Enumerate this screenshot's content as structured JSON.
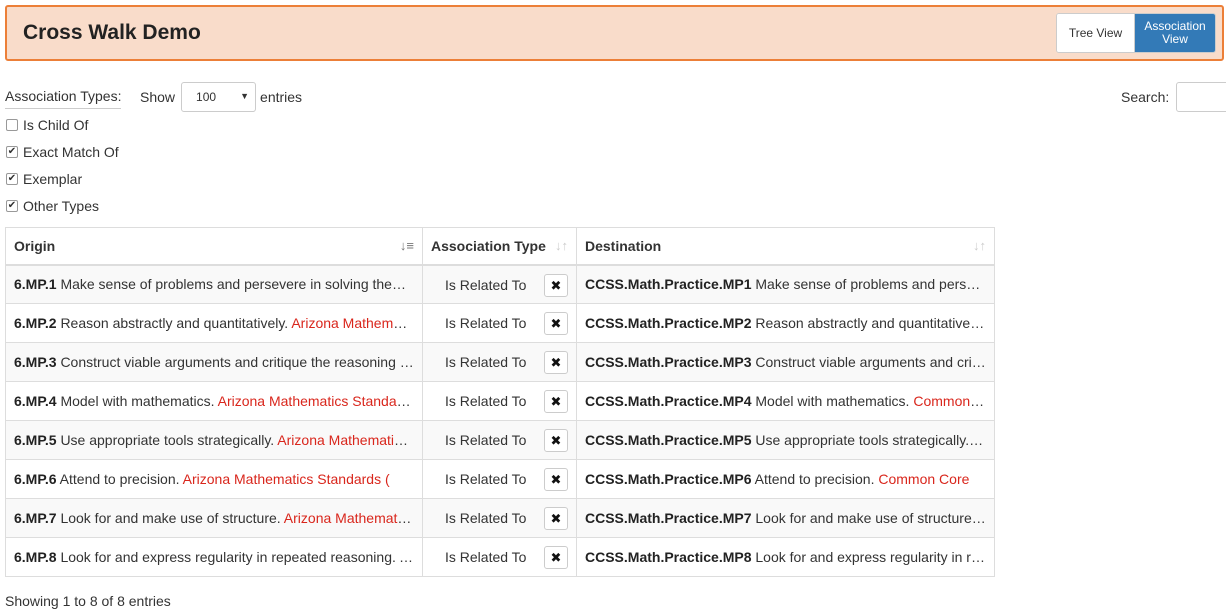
{
  "header": {
    "title": "Cross Walk Demo",
    "tree_view_label": "Tree View",
    "association_view_label": "Association View"
  },
  "filters": {
    "label": "Association Types:",
    "items": [
      {
        "label": "Is Child Of",
        "checked": false
      },
      {
        "label": "Exact Match Of",
        "checked": true
      },
      {
        "label": "Exemplar",
        "checked": true
      },
      {
        "label": "Other Types",
        "checked": true
      }
    ]
  },
  "length_control": {
    "show_label": "Show",
    "value": "100",
    "entries_label": "entries"
  },
  "search": {
    "label": "Search:",
    "value": ""
  },
  "table": {
    "columns": [
      "Origin",
      "Association Type",
      "Destination"
    ],
    "rows": [
      {
        "origin_code": "6.MP.1",
        "origin_text": "Make sense of problems and persevere in solving them. Arizona Mathematics Standards",
        "origin_source": "",
        "assoc": "Is Related To",
        "dest_code": "CCSS.Math.Practice.MP1",
        "dest_text": "Make sense of problems and persevere in solving them.",
        "dest_source": ""
      },
      {
        "origin_code": "6.MP.2",
        "origin_text": "Reason abstractly and quantitatively.",
        "origin_source": "Arizona Mathematics Standards",
        "assoc": "Is Related To",
        "dest_code": "CCSS.Math.Practice.MP2",
        "dest_text": "Reason abstractly and quantitatively. Common Core",
        "dest_source": ""
      },
      {
        "origin_code": "6.MP.3",
        "origin_text": "Construct viable arguments and critique the reasoning of others.",
        "origin_source": "",
        "assoc": "Is Related To",
        "dest_code": "CCSS.Math.Practice.MP3",
        "dest_text": "Construct viable arguments and critique the reasoning of others.",
        "dest_source": ""
      },
      {
        "origin_code": "6.MP.4",
        "origin_text": "Model with mathematics.",
        "origin_source": "Arizona Mathematics Standards",
        "assoc": "Is Related To",
        "dest_code": "CCSS.Math.Practice.MP4",
        "dest_text": "Model with mathematics.",
        "dest_source": "Common Core"
      },
      {
        "origin_code": "6.MP.5",
        "origin_text": "Use appropriate tools strategically.",
        "origin_source": "Arizona Mathematics Standards",
        "assoc": "Is Related To",
        "dest_code": "CCSS.Math.Practice.MP5",
        "dest_text": "Use appropriate tools strategically. Common Core",
        "dest_source": ""
      },
      {
        "origin_code": "6.MP.6",
        "origin_text": "Attend to precision.",
        "origin_source": "Arizona Mathematics Standards (",
        "assoc": "Is Related To",
        "dest_code": "CCSS.Math.Practice.MP6",
        "dest_text": "Attend to precision.",
        "dest_source": "Common Core"
      },
      {
        "origin_code": "6.MP.7",
        "origin_text": "Look for and make use of structure.",
        "origin_source": "Arizona Mathematics Standards",
        "assoc": "Is Related To",
        "dest_code": "CCSS.Math.Practice.MP7",
        "dest_text": "Look for and make use of structure. Common Core",
        "dest_source": ""
      },
      {
        "origin_code": "6.MP.8",
        "origin_text": "Look for and express regularity in repeated reasoning. Arizona",
        "origin_source": "",
        "assoc": "Is Related To",
        "dest_code": "CCSS.Math.Practice.MP8",
        "dest_text": "Look for and express regularity in repeated reasoning.",
        "dest_source": ""
      }
    ]
  },
  "info": "Showing 1 to 8 of 8 entries",
  "icons": {
    "delete": "close-icon",
    "sort_origin": "sort-asc-icon",
    "sort_other": "sort-both-icon"
  }
}
